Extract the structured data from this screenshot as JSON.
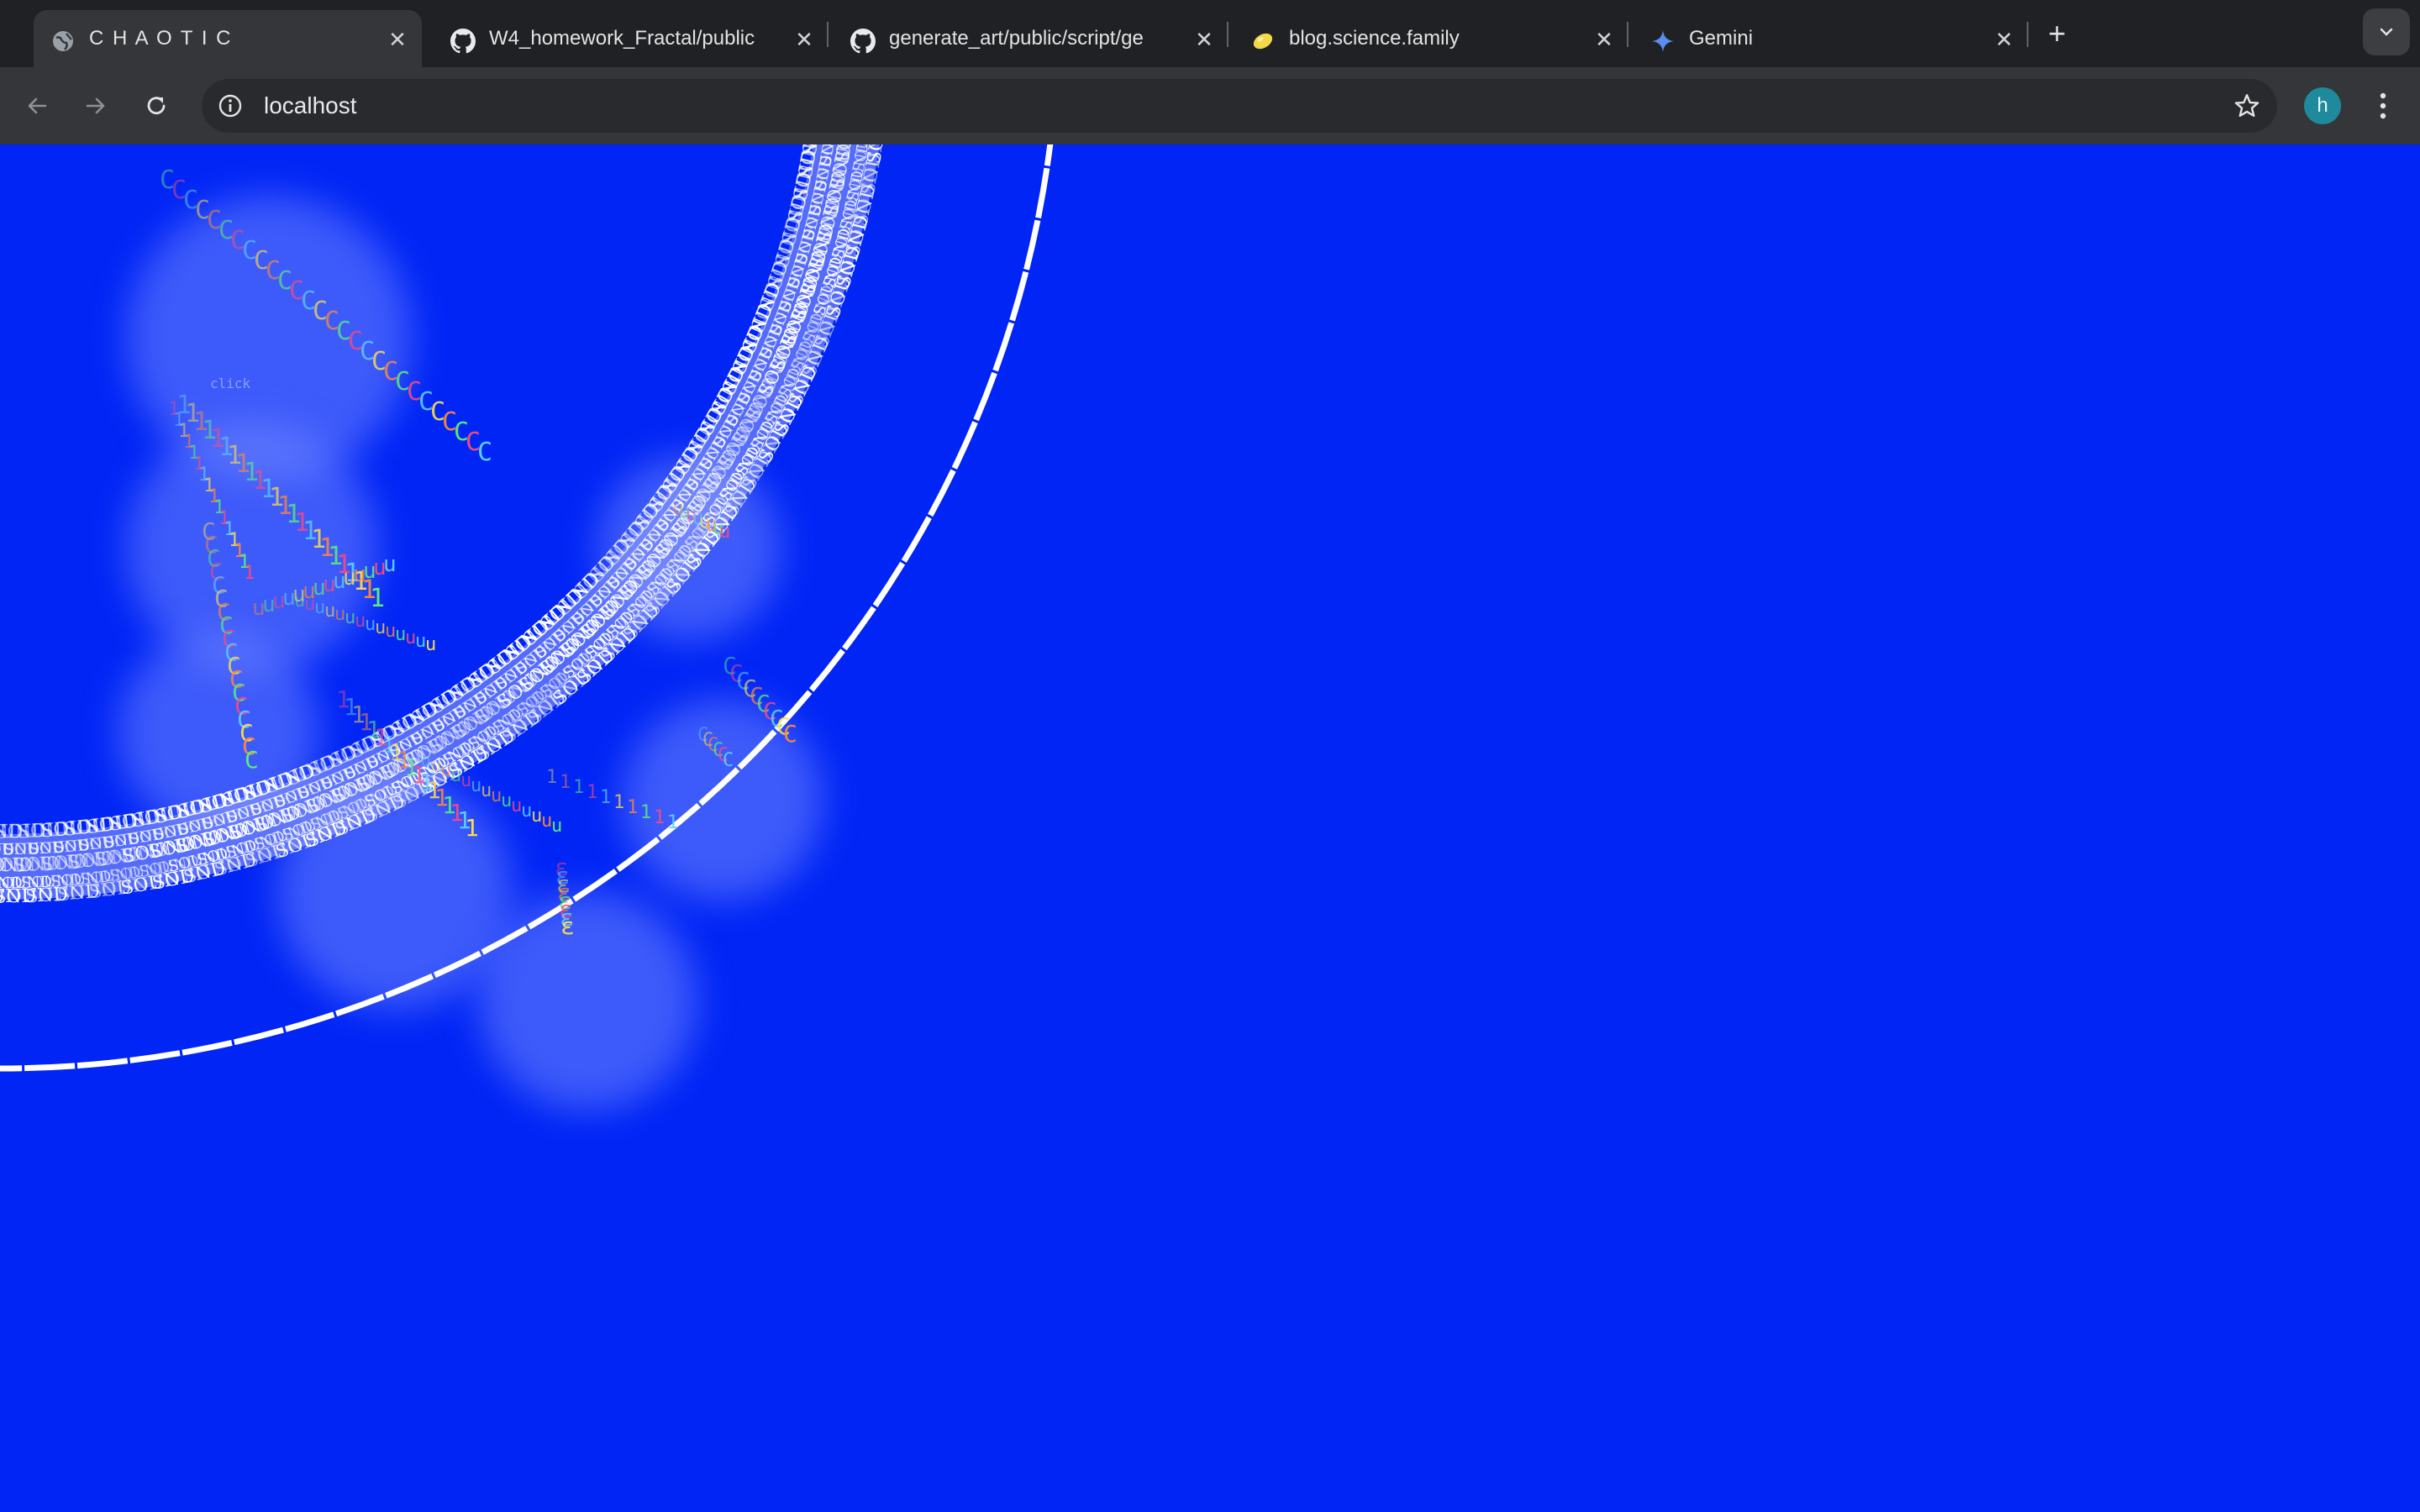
{
  "tabs": [
    {
      "title": "C H A O T I C",
      "icon": "globe-icon",
      "active": true
    },
    {
      "title": "W4_homework_Fractal/public",
      "icon": "github-icon",
      "active": false
    },
    {
      "title": "generate_art/public/script/ge",
      "icon": "github-icon",
      "active": false
    },
    {
      "title": "blog.science.family",
      "icon": "lemon-icon",
      "active": false
    },
    {
      "title": "Gemini",
      "icon": "gemini-icon",
      "active": false
    }
  ],
  "toolbar": {
    "url": "localhost",
    "avatar_initial": "h"
  },
  "canvas": {
    "background": "#0025F5",
    "ring_word": "SOUND",
    "floating_glyphs": [
      "C",
      "1",
      "u",
      "n",
      "ɛ",
      "click"
    ],
    "glyph_colors": [
      "#5cf07a",
      "#ff4a7a",
      "#60d0ff",
      "#ffe14a",
      "#ff8a3a"
    ]
  }
}
